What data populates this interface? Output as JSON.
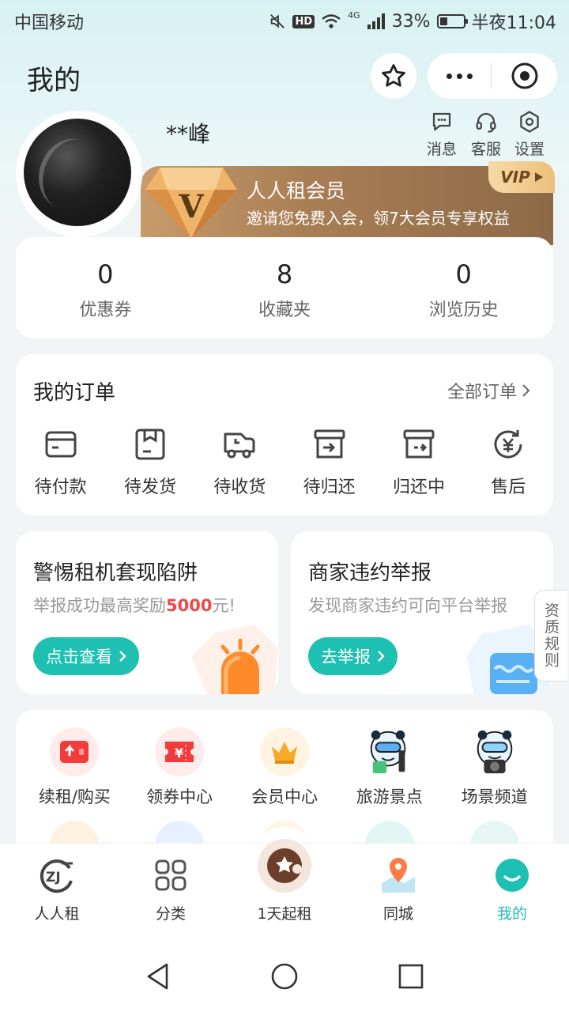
{
  "status_bar": {
    "carrier": "中国移动",
    "hd": "HD",
    "network": "4G",
    "battery": "33%",
    "battery_level": 0.33,
    "time": "半夜11:04"
  },
  "header": {
    "title": "我的"
  },
  "profile": {
    "username": "**峰",
    "quick_actions": [
      {
        "label": "消息",
        "icon": "message-icon"
      },
      {
        "label": "客服",
        "icon": "headset-icon"
      },
      {
        "label": "设置",
        "icon": "settings-icon"
      }
    ]
  },
  "vip": {
    "title": "人人租会员",
    "subtitle": "邀请您免费入会，领7大会员专享权益",
    "tag": "VIP",
    "badge_letter": "V"
  },
  "stats": [
    {
      "value": "0",
      "label": "优惠券"
    },
    {
      "value": "8",
      "label": "收藏夹"
    },
    {
      "value": "0",
      "label": "浏览历史"
    }
  ],
  "orders": {
    "title": "我的订单",
    "all_label": "全部订单",
    "items": [
      {
        "label": "待付款",
        "icon": "wallet-icon"
      },
      {
        "label": "待发货",
        "icon": "package-icon"
      },
      {
        "label": "待收货",
        "icon": "truck-icon"
      },
      {
        "label": "待归还",
        "icon": "return-box-icon"
      },
      {
        "label": "归还中",
        "icon": "returning-box-icon"
      },
      {
        "label": "售后",
        "icon": "after-sale-icon"
      }
    ]
  },
  "promos": [
    {
      "title": "警惕租机套现陷阱",
      "subtitle_prefix": "举报成功最高奖励",
      "subtitle_highlight": "5000",
      "subtitle_suffix": "元!",
      "button": "点击查看"
    },
    {
      "title": "商家违约举报",
      "subtitle": "发现商家违约可向平台举报",
      "button": "去举报"
    }
  ],
  "side_rule": "资质规则",
  "services": [
    {
      "label": "续租/购买",
      "icon": "renew-icon"
    },
    {
      "label": "领券中心",
      "icon": "coupon-icon"
    },
    {
      "label": "会员中心",
      "icon": "crown-icon"
    },
    {
      "label": "旅游景点",
      "icon": "travel-mascot-icon"
    },
    {
      "label": "场景频道",
      "icon": "scene-mascot-icon"
    }
  ],
  "tabs": [
    {
      "label": "人人租",
      "icon": "rrz-logo-icon",
      "active": false
    },
    {
      "label": "分类",
      "icon": "grid-icon",
      "active": false
    },
    {
      "label": "1天起租",
      "icon": "one-day-rent-icon",
      "active": false
    },
    {
      "label": "同城",
      "icon": "location-pin-icon",
      "active": false
    },
    {
      "label": "我的",
      "icon": "profile-smile-icon",
      "active": true
    }
  ],
  "colors": {
    "accent": "#1ec0b2",
    "highlight_red": "#f04848",
    "vip_gold": "#c79b6b"
  }
}
